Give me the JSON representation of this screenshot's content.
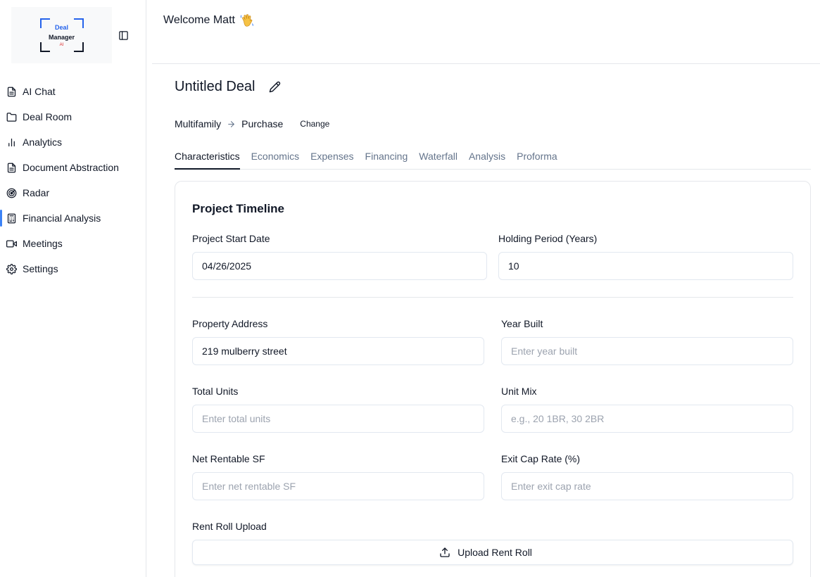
{
  "logo": {
    "line1": "Deal",
    "line2": "Manager",
    "line3": "AI"
  },
  "sidebar": {
    "items": [
      {
        "label": "AI Chat",
        "icon": "document-icon",
        "active": false
      },
      {
        "label": "Deal Room",
        "icon": "folder-icon",
        "active": false
      },
      {
        "label": "Analytics",
        "icon": "bar-chart-icon",
        "active": false
      },
      {
        "label": "Document Abstraction",
        "icon": "document-icon",
        "active": false
      },
      {
        "label": "Radar",
        "icon": "radar-icon",
        "active": false
      },
      {
        "label": "Financial Analysis",
        "icon": "calculator-icon",
        "active": true
      },
      {
        "label": "Meetings",
        "icon": "video-icon",
        "active": false
      },
      {
        "label": "Settings",
        "icon": "gear-icon",
        "active": false
      }
    ]
  },
  "header": {
    "welcome": "Welcome Matt"
  },
  "deal": {
    "title": "Untitled Deal",
    "property_type": "Multifamily",
    "transaction_type": "Purchase",
    "change_label": "Change"
  },
  "tabs": [
    {
      "label": "Characteristics",
      "active": true
    },
    {
      "label": "Economics",
      "active": false
    },
    {
      "label": "Expenses",
      "active": false
    },
    {
      "label": "Financing",
      "active": false
    },
    {
      "label": "Waterfall",
      "active": false
    },
    {
      "label": "Analysis",
      "active": false
    },
    {
      "label": "Proforma",
      "active": false
    }
  ],
  "form": {
    "section_title": "Project Timeline",
    "start_date": {
      "label": "Project Start Date",
      "value": "04/26/2025"
    },
    "holding_period": {
      "label": "Holding Period (Years)",
      "value": "10"
    },
    "address": {
      "label": "Property Address",
      "value": "219 mulberry street"
    },
    "year_built": {
      "label": "Year Built",
      "placeholder": "Enter year built"
    },
    "total_units": {
      "label": "Total Units",
      "placeholder": "Enter total units"
    },
    "unit_mix": {
      "label": "Unit Mix",
      "placeholder": "e.g., 20 1BR, 30 2BR"
    },
    "net_rentable": {
      "label": "Net Rentable SF",
      "placeholder": "Enter net rentable SF"
    },
    "exit_cap": {
      "label": "Exit Cap Rate (%)",
      "placeholder": "Enter exit cap rate"
    },
    "rent_roll": {
      "label": "Rent Roll Upload",
      "button": "Upload Rent Roll"
    }
  },
  "colors": {
    "accent": "#3b82f6",
    "text": "#111827",
    "muted": "#64748b",
    "border": "#e2e8f0"
  }
}
